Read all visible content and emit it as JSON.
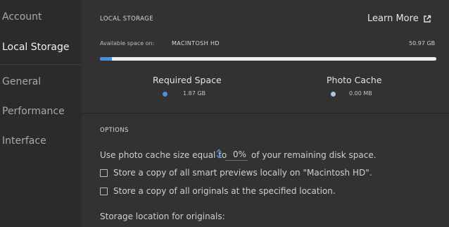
{
  "sidebar": {
    "items": [
      {
        "label": "Account",
        "active": false
      },
      {
        "label": "Local Storage",
        "active": true
      },
      {
        "label": "General",
        "active": false
      },
      {
        "label": "Performance",
        "active": false
      },
      {
        "label": "Interface",
        "active": false
      }
    ]
  },
  "local_storage": {
    "heading": "LOCAL STORAGE",
    "learn_more": "Learn More",
    "available_label": "Available space on:",
    "drive_name": "MACINTOSH HD",
    "available_value": "50.97 GB",
    "usage_fraction_required": 0.035,
    "usage_fraction_cache": 0.0,
    "required": {
      "label": "Required Space",
      "value": "1.87 GB",
      "color": "#4a90d9"
    },
    "cache": {
      "label": "Photo Cache",
      "value": "0.00 MB",
      "color": "#a8c8ea"
    }
  },
  "options": {
    "heading": "OPTIONS",
    "cache_prefix": "Use photo cache size equal to",
    "cache_value": "0%",
    "cache_suffix": "of your remaining disk space.",
    "smart_previews_label": "Store a copy of all smart previews locally on \"Macintosh HD\".",
    "smart_previews_checked": false,
    "originals_label": "Store a copy of all originals at the specified location.",
    "originals_checked": false,
    "storage_location_label": "Storage location for originals:"
  },
  "colors": {
    "accent_blue": "#4a90d9",
    "panel_bg": "#323232",
    "sidebar_bg": "#2b2b2b"
  }
}
